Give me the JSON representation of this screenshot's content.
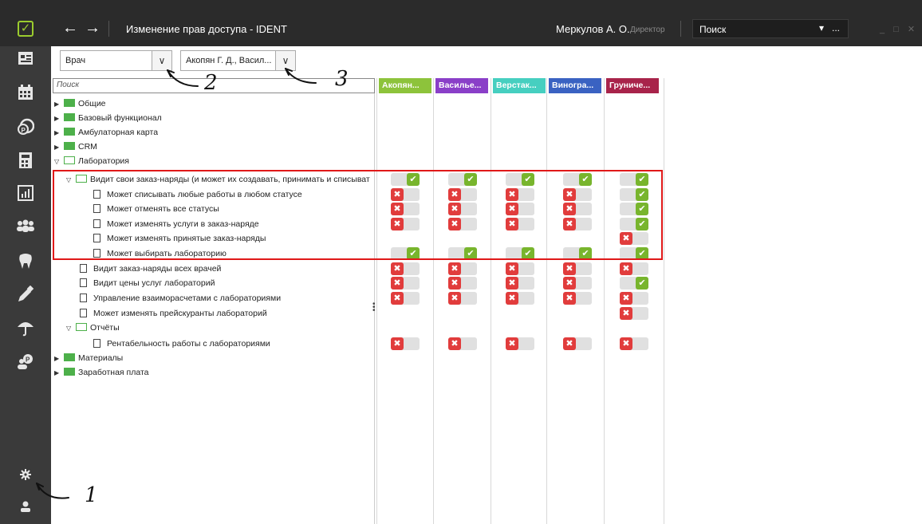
{
  "window": {
    "title": "Изменение прав доступа - IDENT",
    "user": "Меркулов А. О.",
    "role": "Директор",
    "search_placeholder": "Поиск",
    "search_more": "...",
    "search_dropdown": "▾",
    "controls": "_ □ ✕"
  },
  "filters": {
    "role_value": "Врач",
    "doctors_value": "Акопян Г. Д., Васил..."
  },
  "tree": {
    "search_placeholder": "Поиск",
    "rows": [
      {
        "label": "Общие"
      },
      {
        "label": "Базовый функционал"
      },
      {
        "label": "Амбулаторная карта"
      },
      {
        "label": "CRM"
      },
      {
        "label": "Лаборатория"
      },
      {
        "label": "Видит свои заказ-наряды (и может их создавать, принимать и списыват"
      },
      {
        "label": "Может списывать любые работы в любом статусе"
      },
      {
        "label": "Может отменять все статусы"
      },
      {
        "label": "Может изменять услуги в заказ-наряде"
      },
      {
        "label": "Может изменять принятые заказ-наряды"
      },
      {
        "label": "Может выбирать лабораторию"
      },
      {
        "label": "Видит заказ-наряды всех врачей"
      },
      {
        "label": "Видит цены услуг лабораторий"
      },
      {
        "label": "Управление взаиморасчетами с лабораториями"
      },
      {
        "label": "Может изменять прейскуранты лабораторий"
      },
      {
        "label": "Отчёты"
      },
      {
        "label": "Рентабельность работы с лабораториями"
      },
      {
        "label": "Материалы"
      },
      {
        "label": "Заработная плата"
      }
    ]
  },
  "columns": [
    {
      "label": "Акопян...",
      "color": "#8dc33b"
    },
    {
      "label": "Василье...",
      "color": "#8a3fc8"
    },
    {
      "label": "Верстак...",
      "color": "#46cfc0"
    },
    {
      "label": "Виногра...",
      "color": "#3a62c2"
    },
    {
      "label": "Груниче...",
      "color": "#a8234a"
    }
  ],
  "permissions": [
    {
      "row": 5,
      "states": [
        "on",
        "on",
        "on",
        "on",
        "on"
      ]
    },
    {
      "row": 6,
      "states": [
        "off",
        "off",
        "off",
        "off",
        "on"
      ]
    },
    {
      "row": 7,
      "states": [
        "off",
        "off",
        "off",
        "off",
        "on"
      ]
    },
    {
      "row": 8,
      "states": [
        "off",
        "off",
        "off",
        "off",
        "on"
      ]
    },
    {
      "row": 9,
      "states": [
        null,
        null,
        null,
        null,
        "off"
      ]
    },
    {
      "row": 10,
      "states": [
        "on",
        "on",
        "on",
        "on",
        "on"
      ]
    },
    {
      "row": 11,
      "states": [
        "off",
        "off",
        "off",
        "off",
        "off"
      ]
    },
    {
      "row": 12,
      "states": [
        "off",
        "off",
        "off",
        "off",
        "on"
      ]
    },
    {
      "row": 13,
      "states": [
        "off",
        "off",
        "off",
        "off",
        "off"
      ]
    },
    {
      "row": 14,
      "states": [
        null,
        null,
        null,
        null,
        "off"
      ]
    },
    {
      "row": 16,
      "states": [
        "off",
        "off",
        "off",
        "off",
        "off"
      ]
    }
  ],
  "annotations": {
    "one": "1",
    "two": "2",
    "three": "3"
  },
  "icons": {
    "check": "✔",
    "cross": "✖",
    "chevron": "∨",
    "back": "←",
    "forward": "→"
  }
}
